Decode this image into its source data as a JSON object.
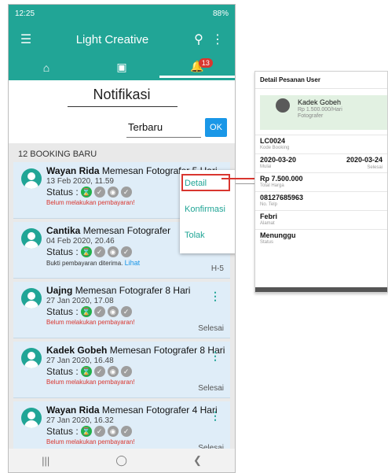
{
  "status_bar": {
    "time": "12:25",
    "battery": "88%"
  },
  "app_bar": {
    "title": "Light Creative"
  },
  "tabs": {
    "notification_badge": "13"
  },
  "page": {
    "title": "Notifikasi"
  },
  "filter": {
    "sort_value": "Terbaru",
    "ok_label": "OK"
  },
  "list_header": "12 BOOKING BARU",
  "status_label": "Status :",
  "bookings": [
    {
      "name": "Wayan Rida",
      "message": "Memesan Fotografer 5 Hari",
      "date": "13 Feb 2020, 11.59",
      "note": "Belum melakukan pembayaran!",
      "note_link": "",
      "right": ""
    },
    {
      "name": "Cantika",
      "message": "Memesan Fotografer",
      "date": "04 Feb 2020, 20.46",
      "note": "Bukti pembayaran diterima.",
      "note_link": "Lihat",
      "right": "H-5"
    },
    {
      "name": "Uajng",
      "message": "Memesan Fotografer 8 Hari",
      "date": "27 Jan 2020, 17.08",
      "note": "Belum melakukan pembayaran!",
      "note_link": "",
      "right": "Selesai"
    },
    {
      "name": "Kadek Gobeh",
      "message": "Memesan Fotografer 8 Hari",
      "date": "27 Jan 2020, 16.48",
      "note": "Belum melakukan pembayaran!",
      "note_link": "",
      "right": "Selesai"
    },
    {
      "name": "Wayan Rida",
      "message": "Memesan Fotografer 4 Hari",
      "date": "27 Jan 2020, 16.32",
      "note": "Belum melakukan pembayaran!",
      "note_link": "",
      "right": "Selesai"
    }
  ],
  "popup_menu": {
    "detail": "Detail",
    "confirm": "Konfirmasi",
    "reject": "Tolak"
  },
  "detail_panel": {
    "title": "Detail Pesanan User",
    "user_name": "Kadek Gobeh",
    "user_price": "Rp 1.500.000/Hari",
    "user_role": "Fotografer",
    "booking_code": "LC0024",
    "booking_code_label": "Kode Booking",
    "start_date": "2020-03-20",
    "start_label": "Mulai",
    "end_date": "2020-03-24",
    "end_label": "Selesai",
    "total": "Rp 7.500.000",
    "total_label": "Total Harga",
    "phone": "08127685963",
    "phone_label": "No. Telp",
    "address": "Febri",
    "address_label": "Alamat",
    "status": "Menunggu",
    "status_label": "Status"
  }
}
